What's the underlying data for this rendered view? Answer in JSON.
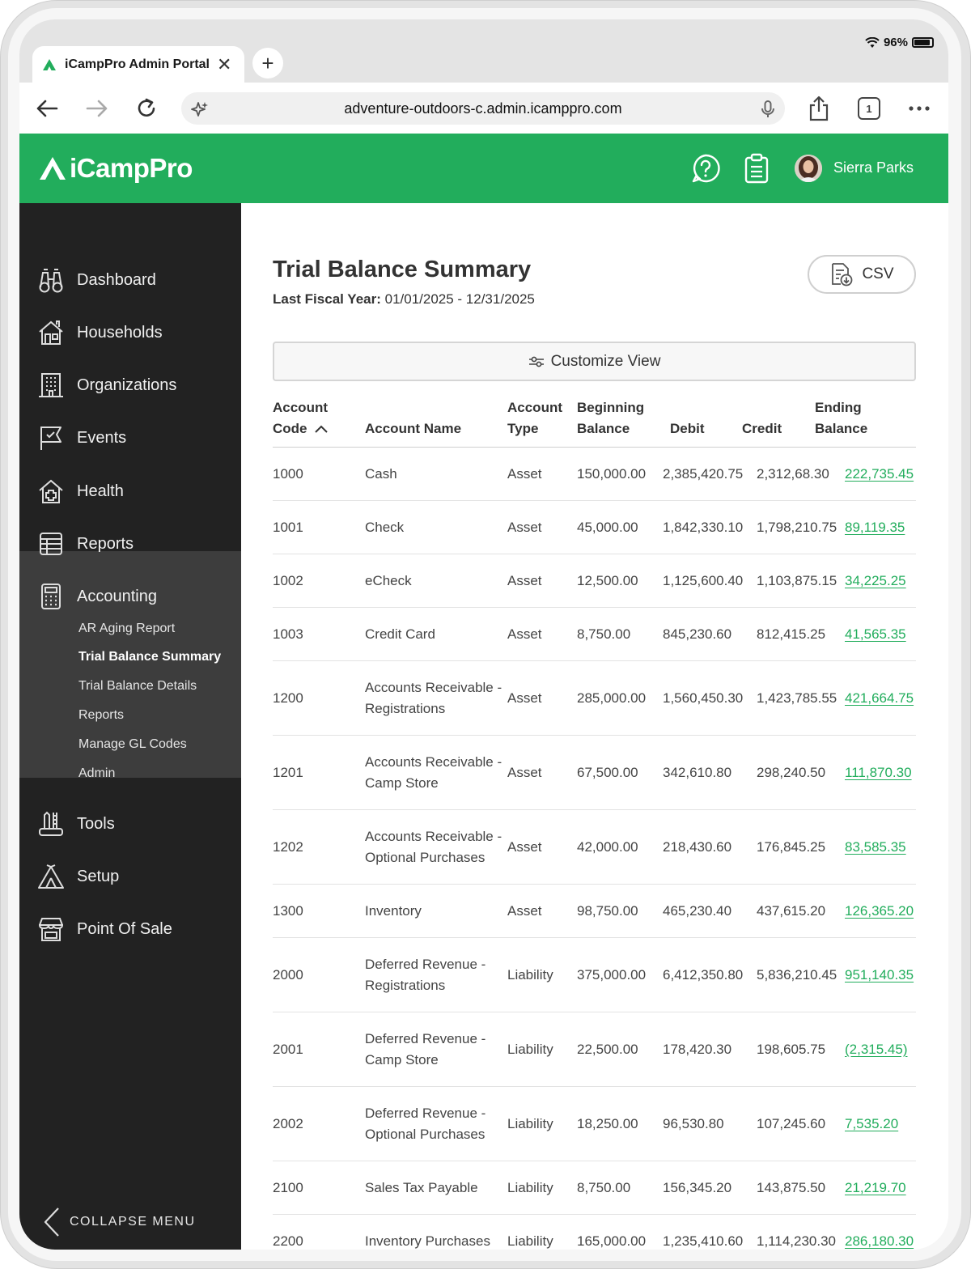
{
  "browser": {
    "tab_title": "iCampPro Admin Portal",
    "url": "adventure-outdoors-c.admin.icamppro.com",
    "battery": "96%",
    "tab_count": "1"
  },
  "header": {
    "logo_text": "iCampPro",
    "user_name": "Sierra Parks"
  },
  "sidebar": {
    "items": [
      {
        "label": "Dashboard",
        "icon": "binoculars-icon"
      },
      {
        "label": "Households",
        "icon": "house-icon"
      },
      {
        "label": "Organizations",
        "icon": "building-icon"
      },
      {
        "label": "Events",
        "icon": "flag-icon"
      },
      {
        "label": "Health",
        "icon": "medical-house-icon"
      },
      {
        "label": "Reports",
        "icon": "report-icon"
      },
      {
        "label": "Accounting",
        "icon": "calculator-icon"
      },
      {
        "label": "Tools",
        "icon": "tools-icon"
      },
      {
        "label": "Setup",
        "icon": "tent-icon"
      },
      {
        "label": "Point Of Sale",
        "icon": "store-icon"
      }
    ],
    "accounting_sub": [
      "AR Aging Report",
      "Trial Balance Summary",
      "Trial Balance Details",
      "Reports",
      "Manage GL Codes",
      "Admin"
    ],
    "collapse_label": "COLLAPSE MENU"
  },
  "main": {
    "title": "Trial Balance Summary",
    "fiscal_label": "Last Fiscal Year:",
    "fiscal_range": "01/01/2025 - 12/31/2025",
    "csv_label": "CSV",
    "customize_label": "Customize View"
  },
  "table": {
    "headers": {
      "code_1": "Account",
      "code_2": "Code",
      "name": "Account Name",
      "type_1": "Account",
      "type_2": "Type",
      "begin_1": "Beginning",
      "begin_2": "Balance",
      "debit": "Debit",
      "credit": "Credit",
      "end_1": "Ending",
      "end_2": "Balance"
    },
    "rows": [
      {
        "code": "1000",
        "name": "Cash",
        "type": "Asset",
        "begin": "150,000.00",
        "debit": "2,385,420.75",
        "credit": "2,312,68.30",
        "end": "222,735.45"
      },
      {
        "code": "1001",
        "name": "Check",
        "type": "Asset",
        "begin": "45,000.00",
        "debit": "1,842,330.10",
        "credit": "1,798,210.75",
        "end": "89,119.35"
      },
      {
        "code": "1002",
        "name": "eCheck",
        "type": "Asset",
        "begin": "12,500.00",
        "debit": "1,125,600.40",
        "credit": "1,103,875.15",
        "end": "34,225.25"
      },
      {
        "code": "1003",
        "name": "Credit Card",
        "type": "Asset",
        "begin": "8,750.00",
        "debit": "845,230.60",
        "credit": "812,415.25",
        "end": "41,565.35"
      },
      {
        "code": "1200",
        "name": "Accounts Receivable - Registrations",
        "type": "Asset",
        "begin": "285,000.00",
        "debit": "1,560,450.30",
        "credit": "1,423,785.55",
        "end": "421,664.75"
      },
      {
        "code": "1201",
        "name": "Accounts Receivable - Camp Store",
        "type": "Asset",
        "begin": "67,500.00",
        "debit": "342,610.80",
        "credit": "298,240.50",
        "end": "111,870.30"
      },
      {
        "code": "1202",
        "name": "Accounts Receivable - Optional Purchases",
        "type": "Asset",
        "begin": "42,000.00",
        "debit": "218,430.60",
        "credit": "176,845.25",
        "end": "83,585.35"
      },
      {
        "code": "1300",
        "name": "Inventory",
        "type": "Asset",
        "begin": "98,750.00",
        "debit": "465,230.40",
        "credit": "437,615.20",
        "end": "126,365.20"
      },
      {
        "code": "2000",
        "name": "Deferred Revenue - Registrations",
        "type": "Liability",
        "begin": "375,000.00",
        "debit": "6,412,350.80",
        "credit": "5,836,210.45",
        "end": "951,140.35"
      },
      {
        "code": "2001",
        "name": "Deferred Revenue - Camp Store",
        "type": "Liability",
        "begin": "22,500.00",
        "debit": "178,420.30",
        "credit": "198,605.75",
        "end": "(2,315.45)"
      },
      {
        "code": "2002",
        "name": "Deferred Revenue - Optional Purchases",
        "type": "Liability",
        "begin": "18,250.00",
        "debit": "96,530.80",
        "credit": "107,245.60",
        "end": "7,535.20"
      },
      {
        "code": "2100",
        "name": "Sales Tax Payable",
        "type": "Liability",
        "begin": "8,750.00",
        "debit": "156,345.20",
        "credit": "143,875.50",
        "end": "21,219.70"
      },
      {
        "code": "2200",
        "name": "Inventory Purchases",
        "type": "Liability",
        "begin": "165,000.00",
        "debit": "1,235,410.60",
        "credit": "1,114,230.30",
        "end": "286,180.30"
      }
    ]
  },
  "colors": {
    "brand_green": "#22ad5c",
    "sidebar_bg": "#222222",
    "sidebar_active_bg": "#3d3d3d"
  }
}
